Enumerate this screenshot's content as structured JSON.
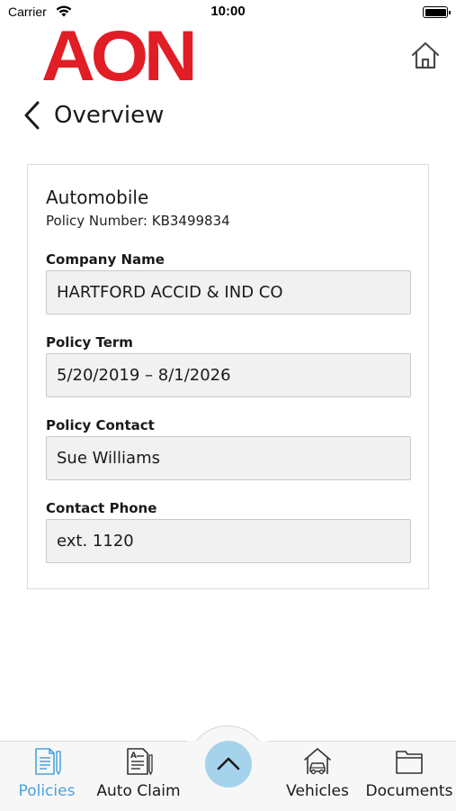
{
  "status_bar": {
    "carrier": "Carrier",
    "time": "10:00",
    "battery_level": 1.0
  },
  "header": {
    "logo_text": "AON",
    "back_icon": "chevron-left-icon",
    "home_icon": "home-icon",
    "title": "Overview"
  },
  "policy": {
    "type": "Automobile",
    "number": "Policy Number: KB3499834",
    "fields": [
      {
        "label": "Company Name",
        "value": "HARTFORD ACCID & IND CO"
      },
      {
        "label": "Policy Term",
        "value": "5/20/2019 – 8/1/2026"
      },
      {
        "label": "Policy Contact",
        "value": "Sue Williams"
      },
      {
        "label": "Contact Phone",
        "value": "ext. 1120"
      }
    ]
  },
  "tab_bar": {
    "tabs": [
      {
        "label": "Policies",
        "icon": "policies-icon",
        "active": true
      },
      {
        "label": "Auto Claim",
        "icon": "auto-claim-icon",
        "active": false
      },
      {
        "label": "Vehicles",
        "icon": "vehicle-icon",
        "active": false
      },
      {
        "label": "Documents",
        "icon": "folder-icon",
        "active": false
      }
    ],
    "center_button_icon": "chevron-up-icon"
  },
  "colors": {
    "brand_red": "#e11d26",
    "accent_blue": "#4aa3dd",
    "fab_blue": "#a5d3ec",
    "field_bg": "#f1f1f1"
  }
}
